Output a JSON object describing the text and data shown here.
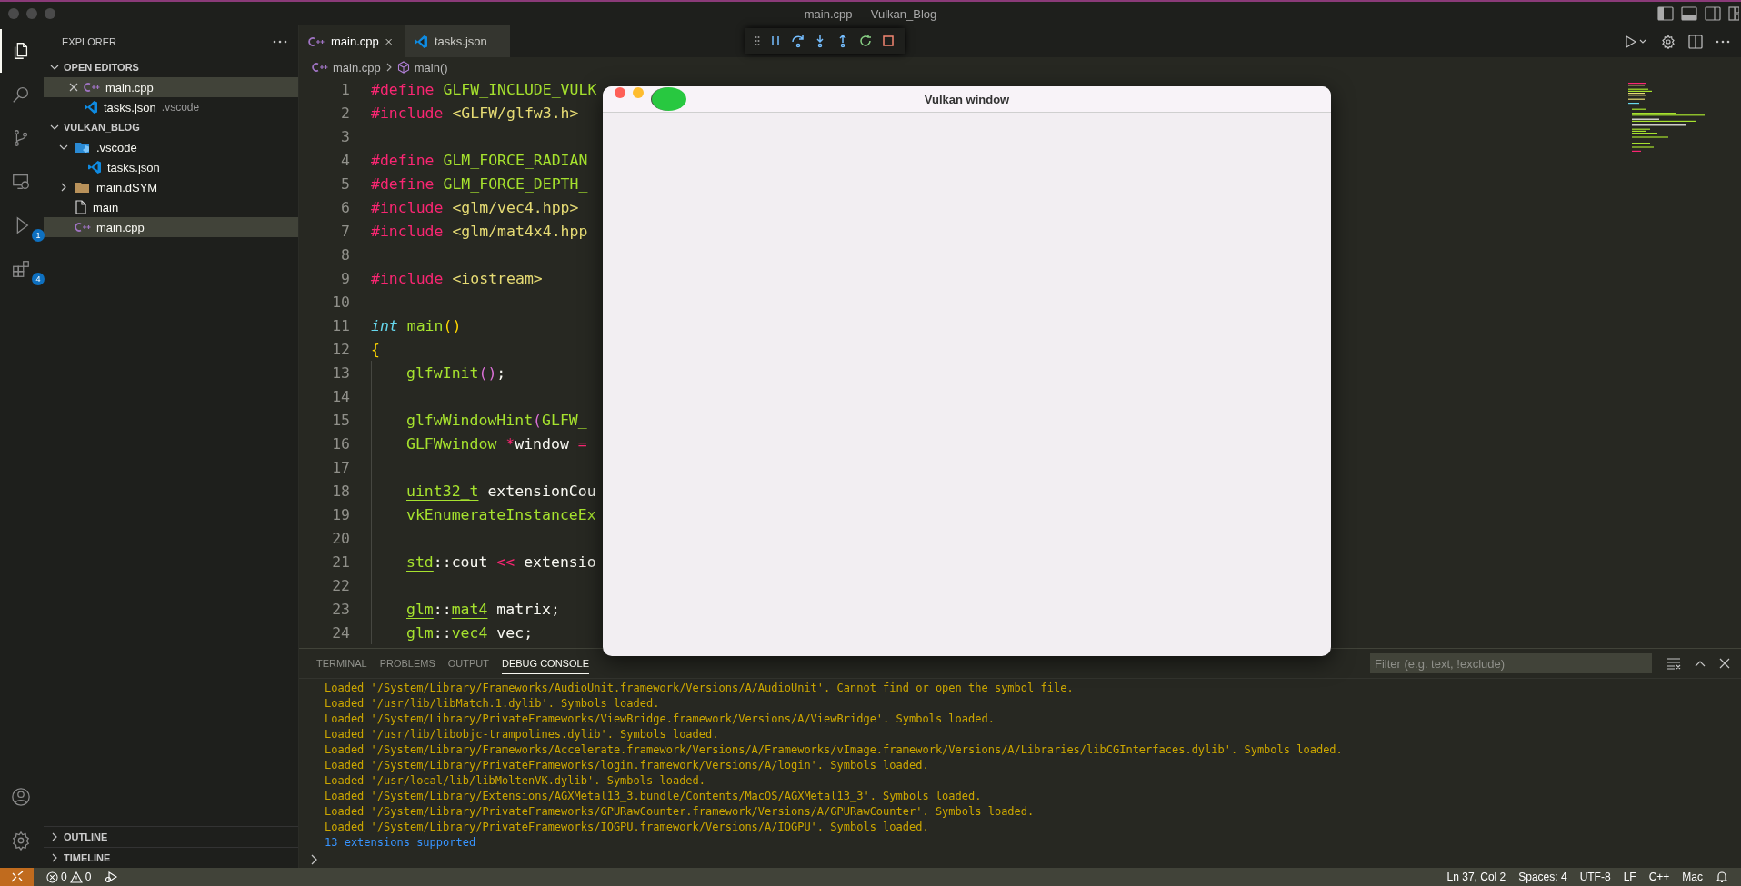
{
  "window": {
    "title": "main.cpp — Vulkan_Blog"
  },
  "activity_bar": {
    "items": [
      {
        "kind": "files",
        "selected": true
      },
      {
        "kind": "search",
        "selected": false
      },
      {
        "kind": "source-control",
        "selected": false
      },
      {
        "kind": "remote",
        "selected": false
      },
      {
        "kind": "run-debug",
        "selected": false,
        "badge": "1"
      },
      {
        "kind": "extensions",
        "selected": false,
        "badge": "4"
      }
    ],
    "bottom": [
      {
        "kind": "account"
      },
      {
        "kind": "settings"
      }
    ]
  },
  "sidebar": {
    "title": "EXPLORER",
    "open_editors": {
      "title": "OPEN EDITORS",
      "expanded": true,
      "items": [
        {
          "name": "main.cpp",
          "kind": "cpp",
          "selected": true,
          "closable": true
        },
        {
          "name": "tasks.json",
          "kind": "json",
          "description": ".vscode",
          "selected": false,
          "closable": false
        }
      ]
    },
    "folder": {
      "title": "VULKAN_BLOG",
      "expanded": true,
      "items": [
        {
          "name": ".vscode",
          "kind": "folder-vscode",
          "expanded": true,
          "selected": false,
          "children": [
            {
              "name": "tasks.json",
              "kind": "json",
              "selected": false
            }
          ]
        },
        {
          "name": "main.dSYM",
          "kind": "folder",
          "expanded": false,
          "selected": false
        },
        {
          "name": "main",
          "kind": "file",
          "selected": false
        },
        {
          "name": "main.cpp",
          "kind": "cpp",
          "selected": true
        }
      ]
    },
    "bottom_sections": [
      {
        "title": "OUTLINE",
        "expanded": false
      },
      {
        "title": "TIMELINE",
        "expanded": false
      }
    ]
  },
  "editor": {
    "tabs": [
      {
        "label": "main.cpp",
        "kind": "cpp",
        "selected": true,
        "closable": true
      },
      {
        "label": "tasks.json",
        "kind": "json",
        "selected": false,
        "closable": false
      }
    ],
    "breadcrumb": [
      {
        "label": "main.cpp",
        "kind": "cpp"
      },
      {
        "label": "main()",
        "kind": "symbol"
      }
    ],
    "lines": [
      {
        "number": "1",
        "tokens": [
          {
            "text": "#define",
            "kind": "keyword"
          },
          {
            "text": " GLFW_INCLUDE_VULK",
            "kind": "macro"
          }
        ]
      },
      {
        "number": "2",
        "tokens": [
          {
            "text": "#include",
            "kind": "keyword"
          },
          {
            "text": " <GLFW/glfw3.h>",
            "kind": "string"
          }
        ]
      },
      {
        "number": "3"
      },
      {
        "number": "4",
        "tokens": [
          {
            "text": "#define",
            "kind": "keyword"
          },
          {
            "text": " GLM_FORCE_RADIAN",
            "kind": "macro"
          }
        ]
      },
      {
        "number": "5",
        "tokens": [
          {
            "text": "#define",
            "kind": "keyword"
          },
          {
            "text": " GLM_FORCE_DEPTH_",
            "kind": "macro"
          }
        ]
      },
      {
        "number": "6",
        "tokens": [
          {
            "text": "#include",
            "kind": "keyword"
          },
          {
            "text": " <glm/vec4.hpp>",
            "kind": "string"
          }
        ]
      },
      {
        "number": "7",
        "tokens": [
          {
            "text": "#include",
            "kind": "keyword"
          },
          {
            "text": " <glm/mat4x4.hpp",
            "kind": "string"
          }
        ]
      },
      {
        "number": "8"
      },
      {
        "number": "9",
        "tokens": [
          {
            "text": "#include",
            "kind": "keyword"
          },
          {
            "text": " <iostream>",
            "kind": "string"
          }
        ]
      },
      {
        "number": "10"
      },
      {
        "number": "11",
        "tokens": [
          {
            "text": "int",
            "kind": "type"
          },
          {
            "text": " main",
            "kind": "function"
          },
          {
            "text": "()",
            "kind": "bracket"
          }
        ]
      },
      {
        "number": "12",
        "tokens": [
          {
            "text": "{",
            "kind": "bracket"
          }
        ],
        "children": [
          {
            "number": "13",
            "tokens": [
              {
                "text": "glfwInit",
                "kind": "function"
              },
              {
                "text": "()",
                "kind": "bracket2"
              },
              {
                "text": ";",
                "kind": "plain"
              }
            ]
          },
          {
            "number": "14"
          },
          {
            "number": "15",
            "tokens": [
              {
                "text": "glfwWindowHint",
                "kind": "function"
              },
              {
                "text": "(",
                "kind": "bracket2"
              },
              {
                "text": "GLFW_",
                "kind": "macro"
              }
            ]
          },
          {
            "number": "16",
            "tokens": [
              {
                "text": "GLFWwindow",
                "kind": "class"
              },
              {
                "text": " *",
                "kind": "operator"
              },
              {
                "text": "window",
                "kind": "plain"
              },
              {
                "text": " =",
                "kind": "operator"
              }
            ]
          },
          {
            "number": "17"
          },
          {
            "number": "18",
            "tokens": [
              {
                "text": "uint32_t",
                "kind": "class"
              },
              {
                "text": " extensionCou",
                "kind": "plain"
              }
            ]
          },
          {
            "number": "19",
            "tokens": [
              {
                "text": "vkEnumerateInstanceEx",
                "kind": "function"
              }
            ]
          },
          {
            "number": "20"
          },
          {
            "number": "21",
            "tokens": [
              {
                "text": "std",
                "kind": "class"
              },
              {
                "text": "::cout",
                "kind": "plain"
              },
              {
                "text": " <<",
                "kind": "operator"
              },
              {
                "text": " extensio",
                "kind": "plain"
              }
            ]
          },
          {
            "number": "22"
          },
          {
            "number": "23",
            "tokens": [
              {
                "text": "glm",
                "kind": "class"
              },
              {
                "text": "::",
                "kind": "plain"
              },
              {
                "text": "mat4",
                "kind": "class"
              },
              {
                "text": " matrix;",
                "kind": "plain"
              }
            ]
          },
          {
            "number": "24",
            "tokens": [
              {
                "text": "glm",
                "kind": "class"
              },
              {
                "text": "::",
                "kind": "plain"
              },
              {
                "text": "vec4",
                "kind": "class"
              },
              {
                "text": " vec;",
                "kind": "plain"
              }
            ]
          }
        ]
      }
    ]
  },
  "debug_toolbar": {
    "buttons": [
      {
        "kind": "pause"
      },
      {
        "kind": "step-over"
      },
      {
        "kind": "step-into"
      },
      {
        "kind": "step-out"
      },
      {
        "kind": "restart"
      },
      {
        "kind": "stop"
      }
    ]
  },
  "panel": {
    "tabs": [
      {
        "label": "TERMINAL",
        "selected": false
      },
      {
        "label": "PROBLEMS",
        "selected": false
      },
      {
        "label": "OUTPUT",
        "selected": false
      },
      {
        "label": "DEBUG CONSOLE",
        "selected": true
      }
    ],
    "filter": {
      "placeholder": "Filter (e.g. text, !exclude)"
    },
    "console": [
      {
        "kind": "log",
        "text": "Loaded '/System/Library/Frameworks/AudioUnit.framework/Versions/A/AudioUnit'. Cannot find or open the symbol file."
      },
      {
        "kind": "log",
        "text": "Loaded '/usr/lib/libMatch.1.dylib'. Symbols loaded."
      },
      {
        "kind": "log",
        "text": "Loaded '/System/Library/PrivateFrameworks/ViewBridge.framework/Versions/A/ViewBridge'. Symbols loaded."
      },
      {
        "kind": "log",
        "text": "Loaded '/usr/lib/libobjc-trampolines.dylib'. Symbols loaded."
      },
      {
        "kind": "log",
        "text": "Loaded '/System/Library/Frameworks/Accelerate.framework/Versions/A/Frameworks/vImage.framework/Versions/A/Libraries/libCGInterfaces.dylib'. Symbols loaded."
      },
      {
        "kind": "log",
        "text": "Loaded '/System/Library/PrivateFrameworks/login.framework/Versions/A/login'. Symbols loaded."
      },
      {
        "kind": "log",
        "text": "Loaded '/usr/local/lib/libMoltenVK.dylib'. Symbols loaded."
      },
      {
        "kind": "log",
        "text": "Loaded '/System/Library/Extensions/AGXMetal13_3.bundle/Contents/MacOS/AGXMetal13_3'. Symbols loaded."
      },
      {
        "kind": "log",
        "text": "Loaded '/System/Library/PrivateFrameworks/GPURawCounter.framework/Versions/A/GPURawCounter'. Symbols loaded."
      },
      {
        "kind": "log",
        "text": "Loaded '/System/Library/PrivateFrameworks/IOGPU.framework/Versions/A/IOGPU'. Symbols loaded."
      },
      {
        "kind": "output",
        "text": "13 extensions supported"
      }
    ]
  },
  "app_window": {
    "title": "Vulkan window"
  },
  "status_bar": {
    "errors": "0",
    "warnings": "0",
    "right": [
      "Ln 37, Col 2",
      "Spaces: 4",
      "UTF-8",
      "LF",
      "C++",
      "Mac"
    ]
  }
}
